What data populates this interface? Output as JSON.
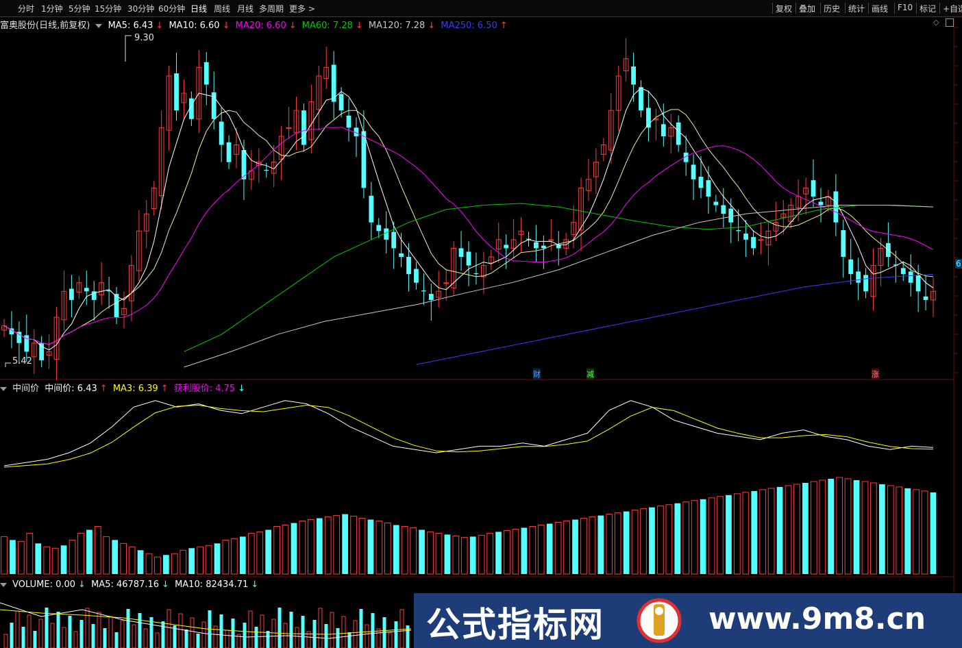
{
  "toolbar": {
    "tabs": [
      "分时",
      "1分钟",
      "5分钟",
      "15分钟",
      "30分钟",
      "60分钟",
      "日线",
      "周线",
      "月线",
      "多周期",
      "更多"
    ],
    "active_tab": "日线",
    "right_buttons": [
      "复权",
      "叠加",
      "历史",
      "统计",
      "画线",
      "F10",
      "标记",
      "+自选"
    ]
  },
  "main_legend": {
    "title": "富奥股份(日线,前复权)",
    "ma5": "MA5: 6.43",
    "ma10": "MA10: 6.60",
    "ma20": "MA20: 6.60",
    "ma60": "MA60: 7.28",
    "ma120": "MA120: 7.28",
    "ma250": "MA250: 6.50",
    "high_label": "9.30",
    "low_label": "5.42",
    "edge_price": "6"
  },
  "markers": [
    "财",
    "减",
    "涨"
  ],
  "indicator_legend": {
    "name": "中间价",
    "value": "中间价: 6.43",
    "ma3": "MA3: 6.39",
    "profit": "获利股价: 4.75"
  },
  "volume_legend": {
    "volume": "VOLUME: 0.00",
    "ma5": "MA5: 46787.16",
    "ma10": "MA10: 82434.71"
  },
  "colors": {
    "up": "#ff3b3b",
    "down": "#54ffff",
    "ma5": "#ffffff",
    "ma10": "#ffff00",
    "ma20": "#ff00ff",
    "ma60": "#00c800",
    "ma120": "#c8c8c8",
    "ma250": "#3a3aff"
  },
  "watermark": {
    "cn": "公式指标网",
    "url": "www.9m8.cn"
  },
  "chart_data": {
    "type": "candlestick",
    "price_range": [
      5.42,
      9.3
    ],
    "closes": [
      5.9,
      5.8,
      5.7,
      5.6,
      5.7,
      5.5,
      5.6,
      6.0,
      6.3,
      6.2,
      6.4,
      6.3,
      6.2,
      6.4,
      6.3,
      6.0,
      6.1,
      6.6,
      7.0,
      7.2,
      7.5,
      8.2,
      8.8,
      8.4,
      8.6,
      8.3,
      8.9,
      8.7,
      8.3,
      8.0,
      7.8,
      8.0,
      7.6,
      7.7,
      7.8,
      7.7,
      7.8,
      8.1,
      8.2,
      8.4,
      8.0,
      8.5,
      8.8,
      8.9,
      8.5,
      8.4,
      8.2,
      8.1,
      7.5,
      7.1,
      7.0,
      6.9,
      6.8,
      6.7,
      6.5,
      6.4,
      6.3,
      6.2,
      6.3,
      6.4,
      6.8,
      6.7,
      6.6,
      6.5,
      6.6,
      6.7,
      6.9,
      6.8,
      6.9,
      7.0,
      6.9,
      6.8,
      6.8,
      6.9,
      6.8,
      6.9,
      7.1,
      7.5,
      7.6,
      7.8,
      8.0,
      8.4,
      8.8,
      9.0,
      8.7,
      8.4,
      8.2,
      8.3,
      8.1,
      8.2,
      8.0,
      7.8,
      7.6,
      7.5,
      7.4,
      7.3,
      7.2,
      7.1,
      7.0,
      6.9,
      6.8,
      6.9,
      7.0,
      7.1,
      7.2,
      7.3,
      7.4,
      7.5,
      7.4,
      7.3,
      7.4,
      7.1,
      6.7,
      6.5,
      6.4,
      6.3,
      6.6,
      6.8,
      6.7,
      6.6,
      6.5,
      6.4,
      6.3,
      6.2,
      6.3
    ],
    "volume": [
      55,
      50,
      48,
      60,
      45,
      40,
      38,
      42,
      50,
      60,
      65,
      70,
      55,
      50,
      45,
      40,
      35,
      30,
      25,
      28,
      30,
      35,
      38,
      40,
      42,
      45,
      50,
      52,
      55,
      60,
      62,
      65,
      70,
      72,
      75,
      78,
      80,
      82,
      84,
      86,
      88,
      85,
      82,
      80,
      78,
      75,
      72,
      70,
      68,
      65,
      62,
      60,
      58,
      56,
      54,
      55,
      57,
      60,
      62,
      64,
      66,
      68,
      70,
      72,
      74,
      76,
      78,
      80,
      82,
      84,
      86,
      88,
      90,
      92,
      94,
      96,
      98,
      100,
      102,
      104,
      106,
      108,
      110,
      112,
      114,
      116,
      118,
      120,
      122,
      124,
      126,
      128,
      130,
      132,
      134,
      136,
      138,
      140,
      142,
      140,
      138,
      136,
      134,
      132,
      130,
      128,
      126,
      124,
      122,
      120
    ],
    "ma60": [
      5.6,
      5.8,
      6.1,
      6.4,
      6.7,
      6.9,
      7.1,
      7.25,
      7.3,
      7.32,
      7.28,
      7.2,
      7.12,
      7.05,
      7.02,
      7.05,
      7.15,
      7.25,
      7.3,
      7.3,
      7.28
    ],
    "ma120": [
      5.42,
      5.6,
      5.8,
      5.95,
      6.05,
      6.15,
      6.28,
      6.4,
      6.55,
      6.75,
      6.95,
      7.1,
      7.2,
      7.25,
      7.3,
      7.3,
      7.28
    ],
    "ma250": [
      5.45,
      5.6,
      5.75,
      5.9,
      6.05,
      6.2,
      6.35,
      6.45,
      6.5
    ],
    "midprice": [
      6.0,
      6.05,
      6.1,
      6.2,
      6.35,
      6.6,
      6.9,
      7.0,
      6.9,
      6.95,
      6.85,
      6.8,
      6.9,
      7.0,
      6.95,
      6.8,
      6.6,
      6.45,
      6.3,
      6.25,
      6.2,
      6.25,
      6.3,
      6.3,
      6.35,
      6.3,
      6.4,
      6.5,
      6.85,
      7.0,
      6.9,
      6.7,
      6.6,
      6.5,
      6.45,
      6.4,
      6.5,
      6.55,
      6.45,
      6.4,
      6.3,
      6.25,
      6.3,
      6.28
    ]
  }
}
